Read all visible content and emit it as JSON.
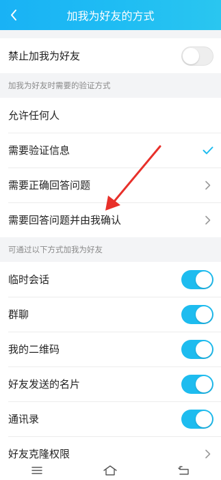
{
  "header": {
    "title": "加我为好友的方式",
    "back_icon": "chevron-left-icon"
  },
  "block_all": {
    "label": "禁止加我为好友",
    "toggle_on": false
  },
  "verification": {
    "header": "加我为好友时需要的验证方式",
    "items": [
      {
        "label": "允许任何人",
        "indicator": "none"
      },
      {
        "label": "需要验证信息",
        "indicator": "check-icon"
      },
      {
        "label": "需要正确回答问题",
        "indicator": "chevron-right-icon"
      },
      {
        "label": "需要回答问题并由我确认",
        "indicator": "chevron-right-icon"
      }
    ]
  },
  "sources": {
    "header": "可通过以下方式加我为好友",
    "items": [
      {
        "label": "临时会话",
        "toggle_on": true
      },
      {
        "label": "群聊",
        "toggle_on": true
      },
      {
        "label": "我的二维码",
        "toggle_on": true
      },
      {
        "label": "好友发送的名片",
        "toggle_on": true
      },
      {
        "label": "通讯录",
        "toggle_on": true
      },
      {
        "label": "好友克隆权限",
        "indicator": "chevron-right-icon"
      }
    ]
  },
  "navbar": {
    "icons": [
      "menu-icon",
      "home-icon",
      "back-icon"
    ]
  },
  "colors": {
    "accent": "#1ebcef",
    "header_start": "#19b2f5",
    "header_end": "#2ac6f0",
    "annotation": "#e8302a"
  }
}
